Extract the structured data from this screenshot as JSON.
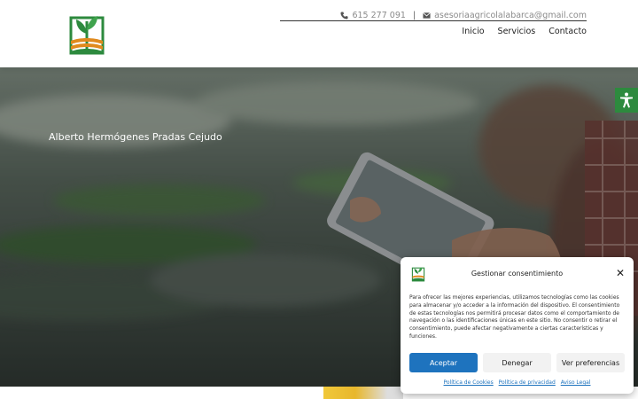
{
  "header": {
    "phone": "615 277 091",
    "separator": "|",
    "email": "asesoriaagricolalabarca@gmail.com",
    "nav": [
      "Inicio",
      "Servicios",
      "Contacto"
    ]
  },
  "hero": {
    "title": "Alberto Hermógenes Pradas Cejudo"
  },
  "consent": {
    "title": "Gestionar consentimiento",
    "close": "✕",
    "body": "Para ofrecer las mejores experiencias, utilizamos tecnologías como las cookies para almacenar y/o acceder a la información del dispositivo. El consentimiento de estas tecnologías nos permitirá procesar datos como el comportamiento de navegación o las identificaciones únicas en este sitio. No consentir o retirar el consentimiento, puede afectar negativamente a ciertas características y funciones.",
    "accept": "Aceptar",
    "deny": "Denegar",
    "preferences": "Ver preferencias",
    "links": [
      "Política de Cookies",
      "Política de privacidad",
      "Aviso Legal"
    ]
  },
  "colors": {
    "accent": "#1e73be",
    "brand_green": "#2d8a3e",
    "brand_orange": "#e08a1e"
  },
  "icons": [
    "phone-icon",
    "envelope-icon",
    "accessibility-icon",
    "close-icon"
  ]
}
